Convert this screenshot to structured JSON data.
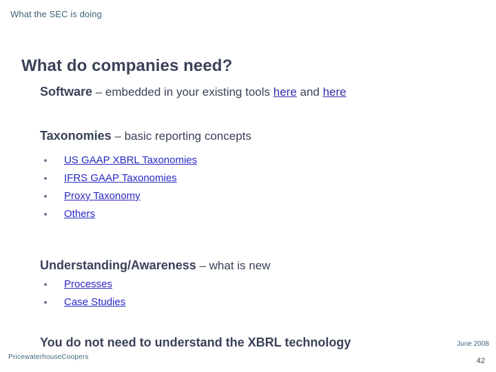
{
  "slide": {
    "kicker": "What the SEC is doing",
    "title": "What do companies need?",
    "sections": {
      "software": {
        "label": "Software",
        "rest_before": " – embedded in your existing tools ",
        "link1": "here",
        "between": " and ",
        "link2": "here"
      },
      "taxonomies": {
        "label": "Taxonomies",
        "rest": " – basic reporting concepts",
        "items": [
          "US GAAP XBRL Taxonomies",
          "IFRS GAAP Taxonomies",
          "Proxy Taxonomy",
          "Others"
        ]
      },
      "awareness": {
        "label": "Understanding/Awareness",
        "rest": " – what is new",
        "items": [
          "Processes",
          "Case Studies"
        ]
      }
    },
    "closing": "You do not need to understand the XBRL technology"
  },
  "footer": {
    "brand": "PricewaterhouseCoopers",
    "date": "June 2008",
    "page_number": "42"
  },
  "colors": {
    "kicker": "#3d6378",
    "heading": "#3a4258",
    "link_purple": "#2f2fa8",
    "link_blue": "#2828c4",
    "bullet": "#6b7a93",
    "background": "#ffffff"
  }
}
